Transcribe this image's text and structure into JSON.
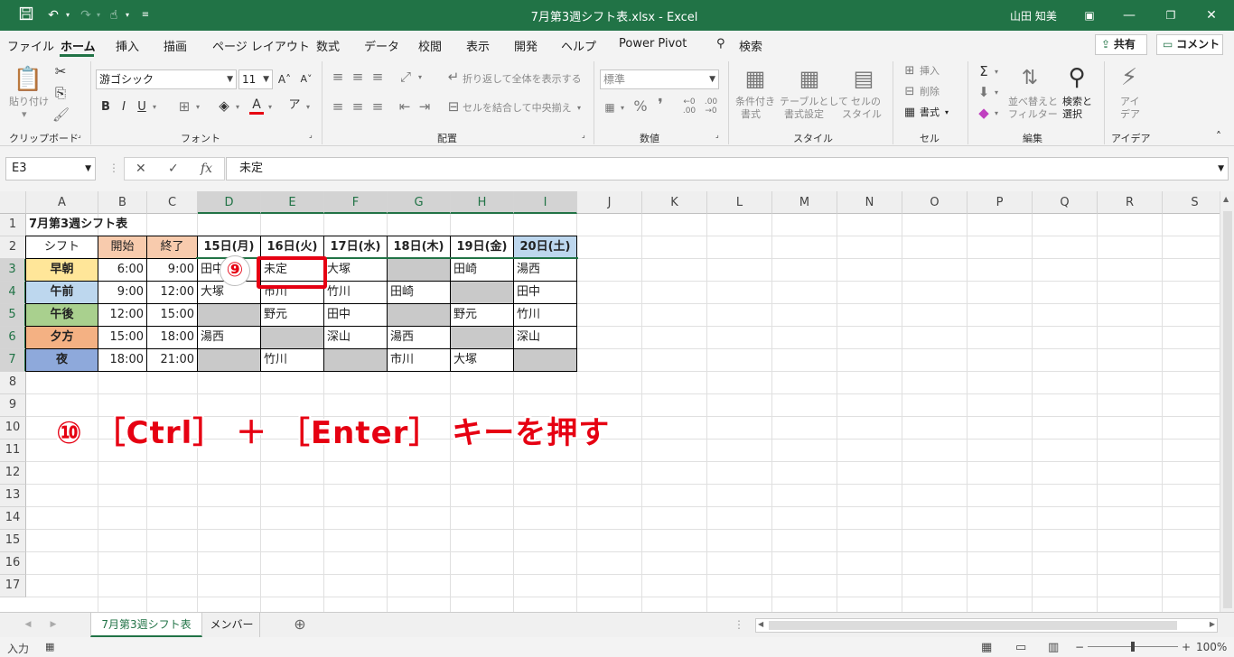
{
  "titlebar": {
    "title": "7月第3週シフト表.xlsx  -  Excel",
    "user": "山田 知美",
    "icons": [
      "save-icon",
      "undo-icon",
      "redo-icon",
      "touch-mode-icon",
      "customize-qat-icon",
      "ribbon-display-icon",
      "minimize-icon",
      "restore-icon",
      "close-icon"
    ]
  },
  "tabs": {
    "items": [
      "ファイル",
      "ホーム",
      "挿入",
      "描画",
      "ページ レイアウト",
      "数式",
      "データ",
      "校閲",
      "表示",
      "開発",
      "ヘルプ",
      "Power Pivot"
    ],
    "search": "検索",
    "share": "共有",
    "comment": "コメント"
  },
  "ribbon": {
    "clipboard": {
      "label": "クリップボード",
      "paste": "貼り付け"
    },
    "font": {
      "label": "フォント",
      "name": "游ゴシック",
      "size": "11",
      "bold": "B",
      "italic": "I",
      "underline": "U",
      "grow": "A˄",
      "shrink": "A˅"
    },
    "alignment": {
      "label": "配置",
      "wrap": "折り返して全体を表示する",
      "merge": "セルを結合して中央揃え"
    },
    "number": {
      "label": "数値",
      "format": "標準",
      "percent": "%"
    },
    "styles": {
      "label": "スタイル",
      "conditional": "条件付き",
      "conditional2": "書式",
      "table": "テーブルとして",
      "table2": "書式設定",
      "cellstyle": "セルの",
      "cellstyle2": "スタイル"
    },
    "cells": {
      "label": "セル",
      "insert": "挿入",
      "delete": "削除",
      "format": "書式"
    },
    "editing": {
      "label": "編集",
      "sort": "並べ替えと",
      "sort2": "フィルター",
      "find": "検索と",
      "find2": "選択"
    },
    "ideas": {
      "label": "アイデア",
      "ideas": "アイ",
      "ideas2": "デア"
    }
  },
  "formula_bar": {
    "name_box": "E3",
    "cancel": "✕",
    "enter": "✓",
    "fx": "fx",
    "value": "未定"
  },
  "sheet": {
    "columns": [
      "A",
      "B",
      "C",
      "D",
      "E",
      "F",
      "G",
      "H",
      "I",
      "J",
      "K",
      "L",
      "M",
      "N",
      "O",
      "P",
      "Q",
      "R",
      "S"
    ],
    "rows": [
      "1",
      "2",
      "3",
      "4",
      "5",
      "6",
      "7",
      "8",
      "9",
      "10",
      "11",
      "12",
      "13",
      "14",
      "15",
      "16",
      "17"
    ],
    "title": "7月第3週シフト表",
    "header": [
      "シフト",
      "開始",
      "終了",
      "15日(月)",
      "16日(火)",
      "17日(水)",
      "18日(木)",
      "19日(金)",
      "20日(土)"
    ],
    "body": [
      [
        "早朝",
        "6:00",
        "9:00",
        "田中",
        "未定",
        "大塚",
        "",
        "田崎",
        "湯西"
      ],
      [
        "午前",
        "9:00",
        "12:00",
        "大塚",
        "市川",
        "竹川",
        "田崎",
        "",
        "田中"
      ],
      [
        "午後",
        "12:00",
        "15:00",
        "",
        "野元",
        "田中",
        "",
        "野元",
        "竹川"
      ],
      [
        "夕方",
        "15:00",
        "18:00",
        "湯西",
        "",
        "深山",
        "湯西",
        "",
        "深山"
      ],
      [
        "夜",
        "18:00",
        "21:00",
        "",
        "竹川",
        "",
        "市川",
        "大塚",
        ""
      ]
    ],
    "shift_colors": [
      "#ffe699",
      "#bdd7ee",
      "#a9d08e",
      "#f4b183",
      "#8ea9db"
    ],
    "time_header_color": "#f8cbad",
    "saturday_color": "#bdd7ee",
    "empty_color": "#c9c9c9",
    "selected_cell": "E3"
  },
  "annotations": {
    "step9": "⑨",
    "step10": "⑩ ［Ctrl］ ＋ ［Enter］ キーを押す",
    "color": "#e60012"
  },
  "sheet_tabs": {
    "items": [
      "7月第3週シフト表",
      "メンバー"
    ],
    "add": "⊕"
  },
  "statusbar": {
    "mode": "入力",
    "zoom": "100%"
  }
}
